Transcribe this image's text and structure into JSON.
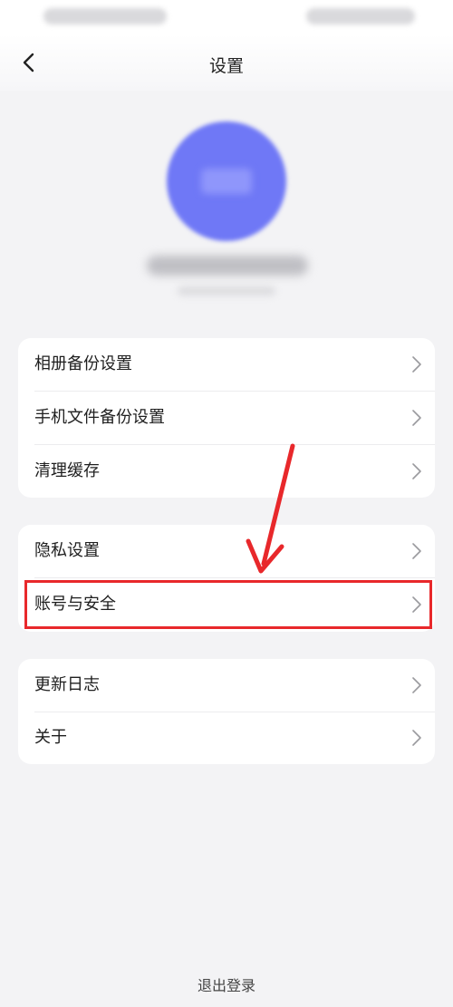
{
  "header": {
    "title": "设置"
  },
  "icons": {
    "back": "chevron-left-icon",
    "row_arrow": "chevron-right-icon"
  },
  "groups": [
    {
      "items": [
        {
          "label": "相册备份设置"
        },
        {
          "label": "手机文件备份设置"
        },
        {
          "label": "清理缓存"
        }
      ]
    },
    {
      "items": [
        {
          "label": "隐私设置"
        },
        {
          "label": "账号与安全"
        }
      ]
    },
    {
      "items": [
        {
          "label": "更新日志"
        },
        {
          "label": "关于"
        }
      ]
    }
  ],
  "footer": {
    "logout_label": "退出登录"
  },
  "colors": {
    "accent_avatar": "#6f78f6",
    "annotation_red": "#e8282b",
    "background": "#f3f3f5",
    "card": "#ffffff"
  }
}
